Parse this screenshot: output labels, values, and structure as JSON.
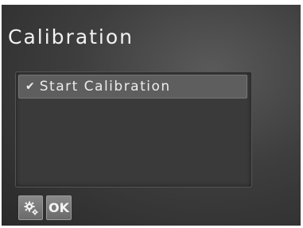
{
  "screen": {
    "title": "Calibration"
  },
  "list": {
    "items": [
      {
        "label": "Start Calibration",
        "selected": true,
        "icon": "check-icon"
      }
    ]
  },
  "footer": {
    "settings_icon": "gears-icon",
    "ok_label": "OK"
  },
  "colors": {
    "background": "#3e3e3e",
    "selection": "#5e5e5e",
    "text": "#f2f2f2"
  }
}
